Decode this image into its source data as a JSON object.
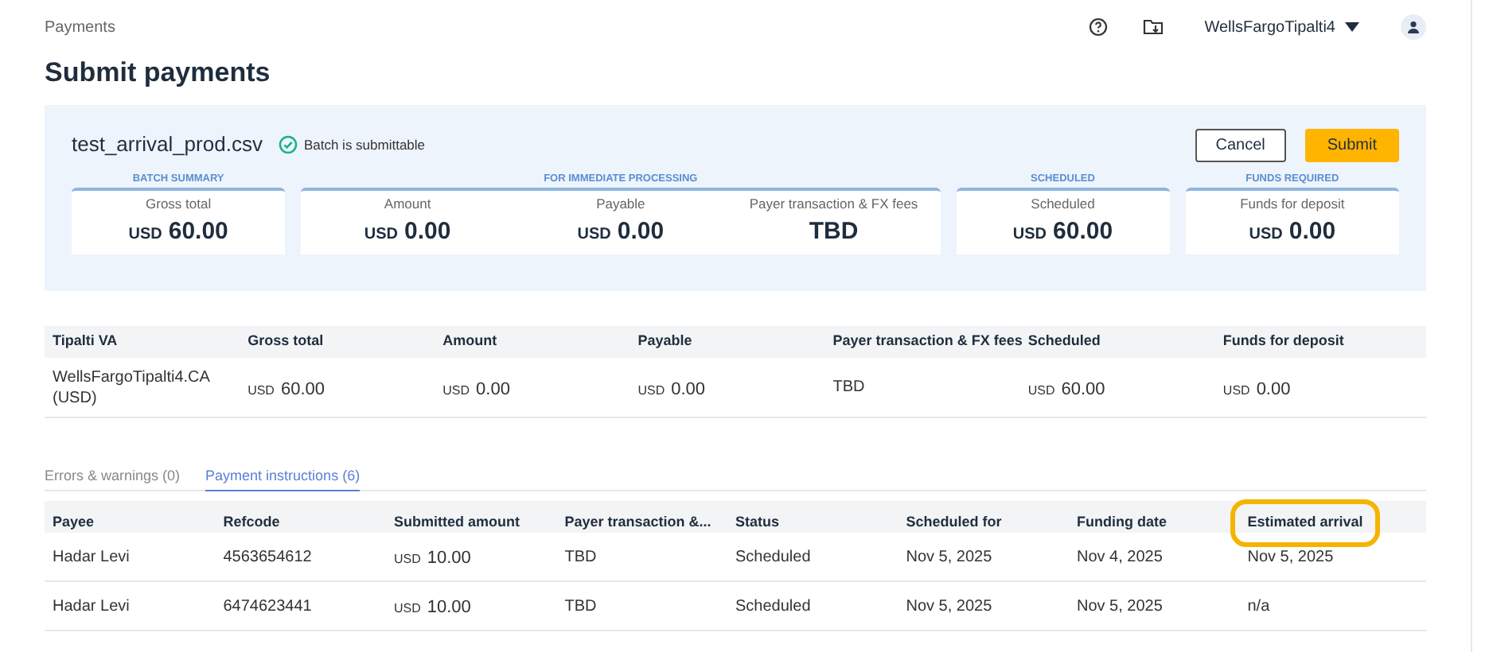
{
  "header": {
    "breadcrumb": "Payments",
    "account": "WellsFargoTipalti4"
  },
  "title": "Submit payments",
  "batch": {
    "file": "test_arrival_prod.csv",
    "status": "Batch is submittable",
    "buttons": [
      {
        "label": "Cancel",
        "kind": "secondary"
      },
      {
        "label": "Submit",
        "kind": "primary"
      }
    ],
    "groups": [
      {
        "label": "BATCH SUMMARY",
        "metrics": [
          {
            "label": "Gross total",
            "currency": "USD",
            "amount": "60.00"
          }
        ]
      },
      {
        "label": "FOR IMMEDIATE PROCESSING",
        "metrics": [
          {
            "label": "Amount",
            "currency": "USD",
            "amount": "0.00"
          },
          {
            "label": "Payable",
            "currency": "USD",
            "amount": "0.00"
          },
          {
            "label": "Payer transaction & FX fees",
            "amount": "TBD"
          }
        ]
      },
      {
        "label": "SCHEDULED",
        "metrics": [
          {
            "label": "Scheduled",
            "currency": "USD",
            "amount": "60.00"
          }
        ]
      },
      {
        "label": "FUNDS REQUIRED",
        "metrics": [
          {
            "label": "Funds for deposit",
            "currency": "USD",
            "amount": "0.00"
          }
        ]
      }
    ]
  },
  "va_table": {
    "columns": [
      "Tipalti VA",
      "Gross total",
      "Amount",
      "Payable",
      "Payer transaction & FX fees",
      "Scheduled",
      "Funds for deposit"
    ],
    "rows": [
      [
        {
          "text": "WellsFargoTipalti4.CA (USD)"
        },
        {
          "currency": "USD",
          "text": "60.00"
        },
        {
          "currency": "USD",
          "text": "0.00"
        },
        {
          "currency": "USD",
          "text": "0.00"
        },
        {
          "text": "TBD"
        },
        {
          "currency": "USD",
          "text": "60.00"
        },
        {
          "currency": "USD",
          "text": "0.00"
        }
      ]
    ]
  },
  "tabs": [
    {
      "label": "Errors & warnings (0)",
      "selected": false
    },
    {
      "label": "Payment instructions (6)",
      "selected": true
    }
  ],
  "payments_table": {
    "columns": [
      {
        "label": "Payee",
        "highlighted": false
      },
      {
        "label": "Refcode",
        "highlighted": false
      },
      {
        "label": "Submitted amount",
        "highlighted": false
      },
      {
        "label": "Payer transaction &...",
        "highlighted": false
      },
      {
        "label": "Status",
        "highlighted": false
      },
      {
        "label": "Scheduled for",
        "highlighted": false
      },
      {
        "label": "Funding date",
        "highlighted": false
      },
      {
        "label": "Estimated arrival",
        "highlighted": true
      }
    ],
    "rows": [
      [
        {
          "text": "Hadar Levi"
        },
        {
          "text": "4563654612"
        },
        {
          "currency": "USD",
          "text": "10.00"
        },
        {
          "text": "TBD"
        },
        {
          "text": "Scheduled"
        },
        {
          "text": "Nov 5, 2025"
        },
        {
          "text": "Nov 4, 2025"
        },
        {
          "text": "Nov 5, 2025"
        }
      ],
      [
        {
          "text": "Hadar Levi"
        },
        {
          "text": "6474623441"
        },
        {
          "currency": "USD",
          "text": "10.00"
        },
        {
          "text": "TBD"
        },
        {
          "text": "Scheduled"
        },
        {
          "text": "Nov 5, 2025"
        },
        {
          "text": "Nov 5, 2025"
        },
        {
          "text": "n/a"
        }
      ]
    ]
  }
}
